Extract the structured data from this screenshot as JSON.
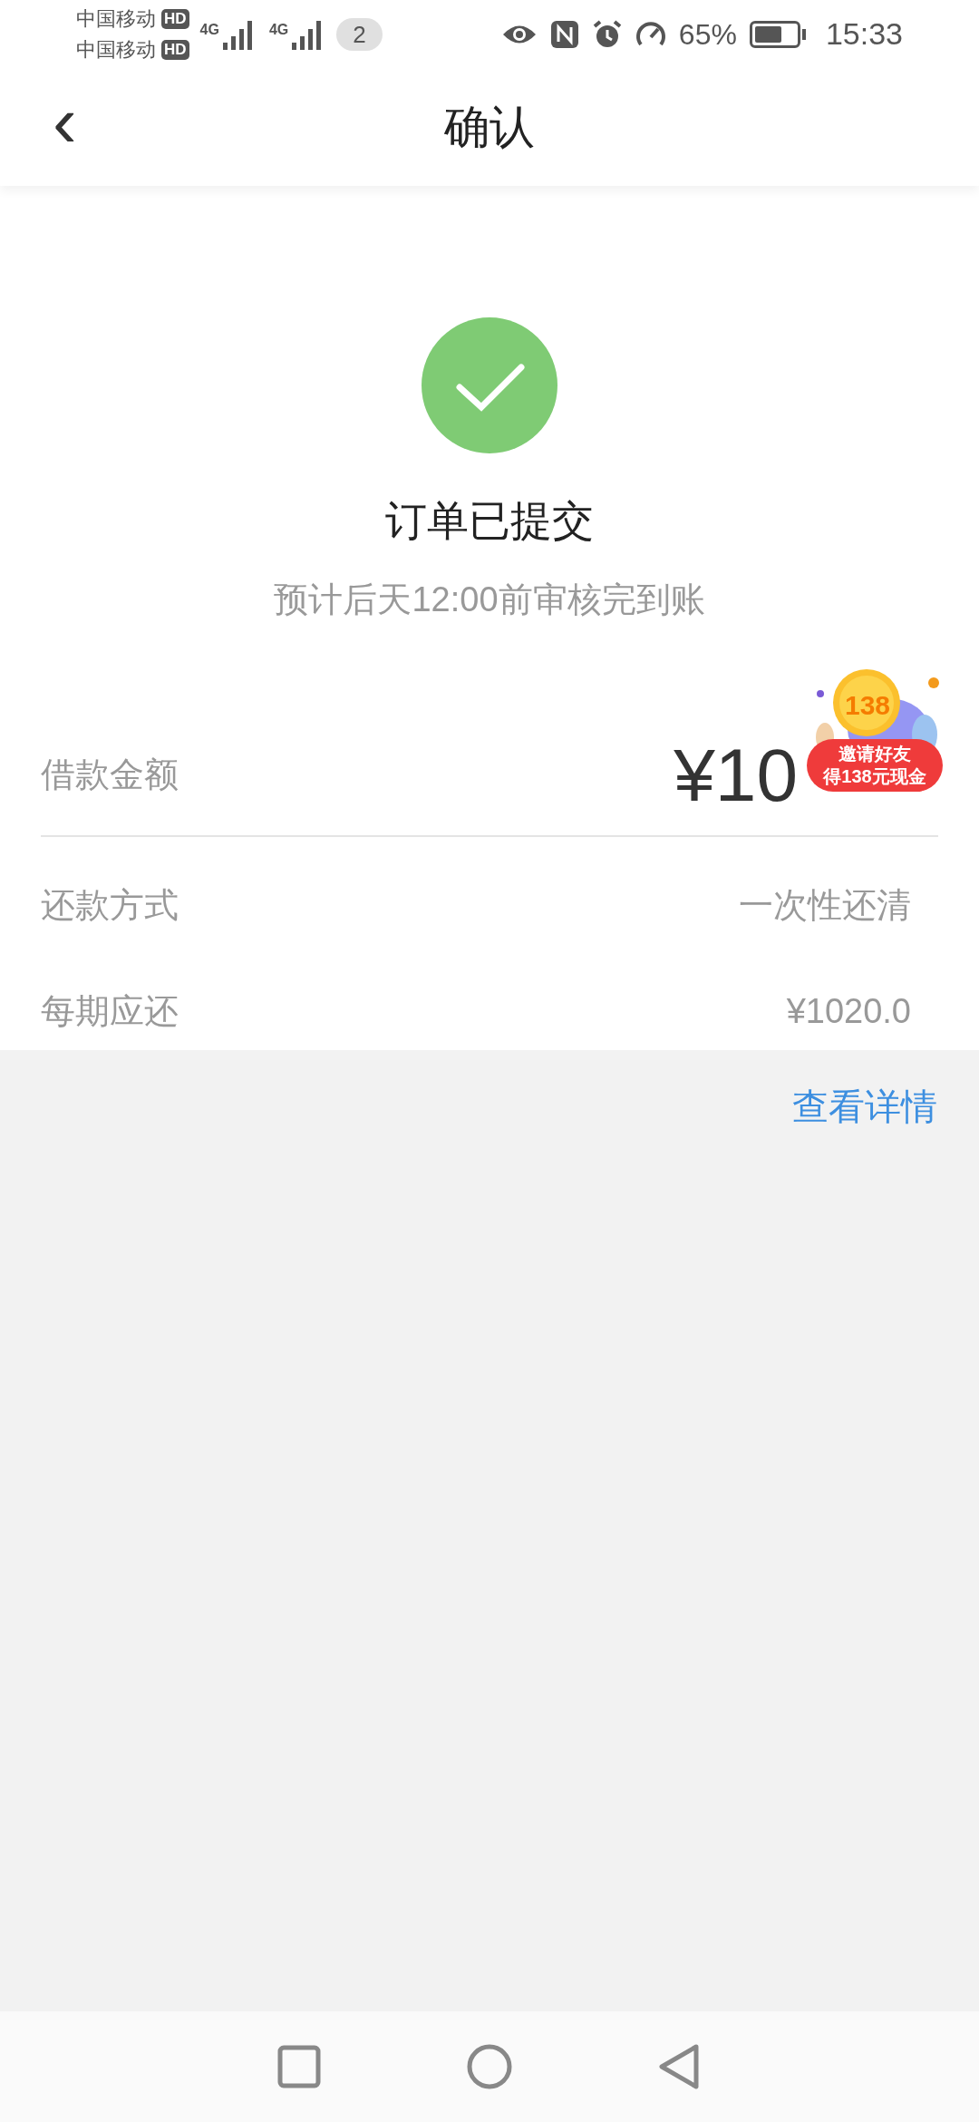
{
  "status_bar": {
    "carriers": [
      {
        "name": "中国移动",
        "badge": "HD"
      },
      {
        "name": "中国移动",
        "badge": "HD"
      }
    ],
    "networks": [
      "4G",
      "4G"
    ],
    "sim_count": "2",
    "battery_percent": "65%",
    "time": "15:33"
  },
  "header": {
    "back": "‹",
    "title": "确认"
  },
  "result": {
    "title": "订单已提交",
    "subtitle": "预计后天12:00前审核完到账"
  },
  "details": [
    {
      "label": "借款金额",
      "value": "¥10",
      "kind": "amount"
    },
    {
      "label": "还款方式",
      "value": "一次性还清",
      "kind": "plain"
    },
    {
      "label": "每期应还",
      "value": "¥1020.0",
      "kind": "plain"
    }
  ],
  "promo": {
    "coin": "138",
    "text_line1": "邀请好友",
    "text_line2": "得138元现金"
  },
  "link": "查看详情"
}
